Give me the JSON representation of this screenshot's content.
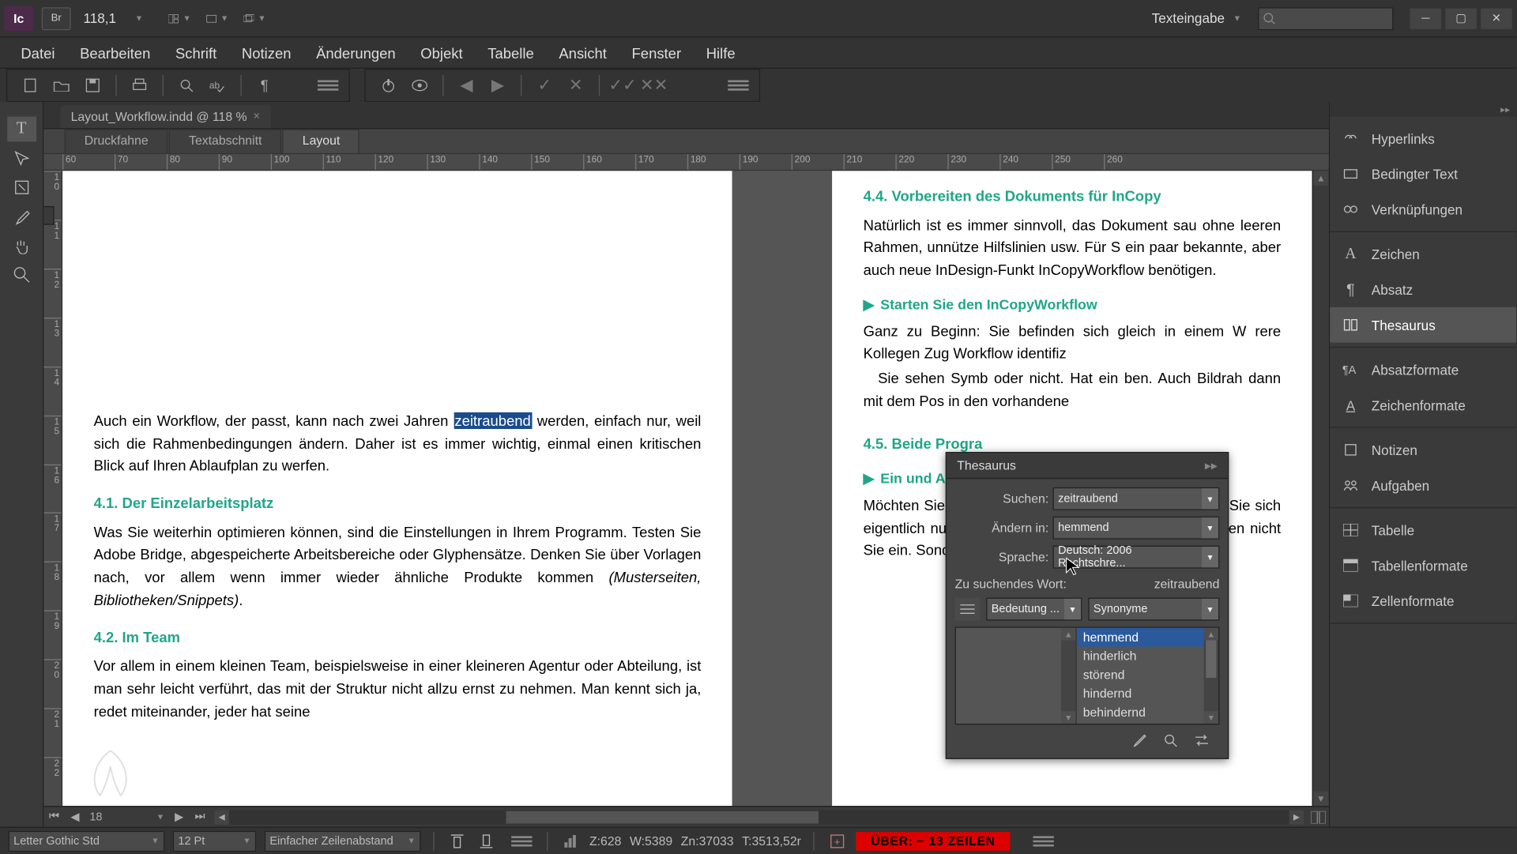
{
  "app": {
    "short_name": "Ic",
    "bridge_label": "Br"
  },
  "titlebar": {
    "zoom_value": "118,1",
    "workspace": "Texteingabe"
  },
  "menu": {
    "file": "Datei",
    "edit": "Bearbeiten",
    "type": "Schrift",
    "notes": "Notizen",
    "changes": "Änderungen",
    "object": "Objekt",
    "table": "Tabelle",
    "view": "Ansicht",
    "window": "Fenster",
    "help": "Hilfe"
  },
  "document": {
    "tab_title": "Layout_Workflow.indd @ 118 %",
    "view_tabs": {
      "galley": "Druckfahne",
      "story": "Textabschnitt",
      "layout": "Layout",
      "active": "layout"
    },
    "ruler_h": [
      "60",
      "70",
      "80",
      "90",
      "100",
      "110",
      "120",
      "130",
      "140",
      "150",
      "160",
      "170",
      "180",
      "190",
      "200",
      "210",
      "220",
      "230",
      "240",
      "250",
      "260"
    ],
    "ruler_v_left": [
      "10",
      "11",
      "12",
      "13",
      "14",
      "15",
      "16",
      "17",
      "18",
      "19",
      "20",
      "21",
      "22"
    ],
    "left_page": {
      "p1_before": "Auch ein Workflow, der passt, kann nach zwei Jahren ",
      "highlighted": "zeitraubend",
      "p1_after": " werden, einfach nur, weil sich die Rahmenbedingungen ändern. Daher ist es immer wichtig, einmal einen kritischen Blick auf Ihren Ablaufplan zu werfen.",
      "h1": "4.1.   Der Einzelarbeitsplatz",
      "p2": "Was Sie weiterhin optimieren können, sind die Einstellungen in Ihrem Programm. Testen Sie Adobe Bridge, abgespeicherte Arbeitsbereiche oder Glyphensätze. Denken Sie über Vorlagen nach, vor allem wenn immer wieder ähnliche Produkte kommen ",
      "p2_em": "(Musterseiten, Bibliotheken/Snippets)",
      "p2_end": ".",
      "h2": "4.2.   Im Team",
      "p3": "Vor allem in einem kleinen Team, beispielsweise in einer kleineren Agentur oder Abteilung, ist man sehr leicht verführt, das mit der Struktur nicht allzu ernst zu nehmen. Man kennt sich ja, redet miteinander, jeder hat seine"
    },
    "right_page": {
      "h1": "4.4.   Vorbereiten des Dokuments für InCopy",
      "p1": "Natürlich ist es immer sinnvoll, das Dokument sau ohne leeren Rahmen, unnütze Hilfslinien usw. Für S ein paar bekannte, aber auch neue InDesign-Funkt InCopyWorkflow benötigen.",
      "sub1": "Starten Sie den InCopyWorkflow",
      "p2": "Ganz zu Beginn: Sie befinden sich gleich in einem W rere Kollegen Zug Workflow identifiz",
      "p3": "Sie sehen Symb oder nicht. Hat ein ben. Auch Bildrah dann mit dem Pos in den vorhandene",
      "h2": "4.5.   Beide Progra",
      "sub2": "Ein und Ausche",
      "p4": "Möchten Sie im T checken Sie ihn w le Starter andersh Sie sich eigentlich nur eines vor Augen halten: Um e ten, checken nicht Sie ein. Sondern Sie holen den"
    }
  },
  "thesaurus": {
    "title": "Thesaurus",
    "labels": {
      "search": "Suchen:",
      "change_to": "Ändern in:",
      "language": "Sprache:",
      "lookup_word": "Zu suchendes Wort:"
    },
    "search_value": "zeitraubend",
    "change_to_value": "hemmend",
    "language_value": "Deutsch: 2006 Rechtschre...",
    "lookup_value": "zeitraubend",
    "meaning_label": "Bedeutung ...",
    "relation_label": "Synonyme",
    "results": [
      "hemmend",
      "hinderlich",
      "störend",
      "hindernd",
      "behindernd"
    ],
    "selected_result": "hemmend"
  },
  "right_dock": {
    "hyperlinks": "Hyperlinks",
    "conditional_text": "Bedingter Text",
    "cross_refs": "Verknüpfungen",
    "character": "Zeichen",
    "paragraph": "Absatz",
    "thesaurus": "Thesaurus",
    "para_styles": "Absatzformate",
    "char_styles": "Zeichenformate",
    "notes": "Notizen",
    "assignments": "Aufgaben",
    "table": "Tabelle",
    "table_styles": "Tabellenformate",
    "cell_styles": "Zellenformate"
  },
  "nav": {
    "page": "18"
  },
  "status": {
    "font": "Letter Gothic Std",
    "size": "12 Pt",
    "leading": "Einfacher Zeilenabstand",
    "z": "Z:628",
    "w": "W:5389",
    "zn": "Zn:37033",
    "t": "T:3513,52r",
    "warning": "ÜBER:  ~ 13 ZEILEN"
  }
}
